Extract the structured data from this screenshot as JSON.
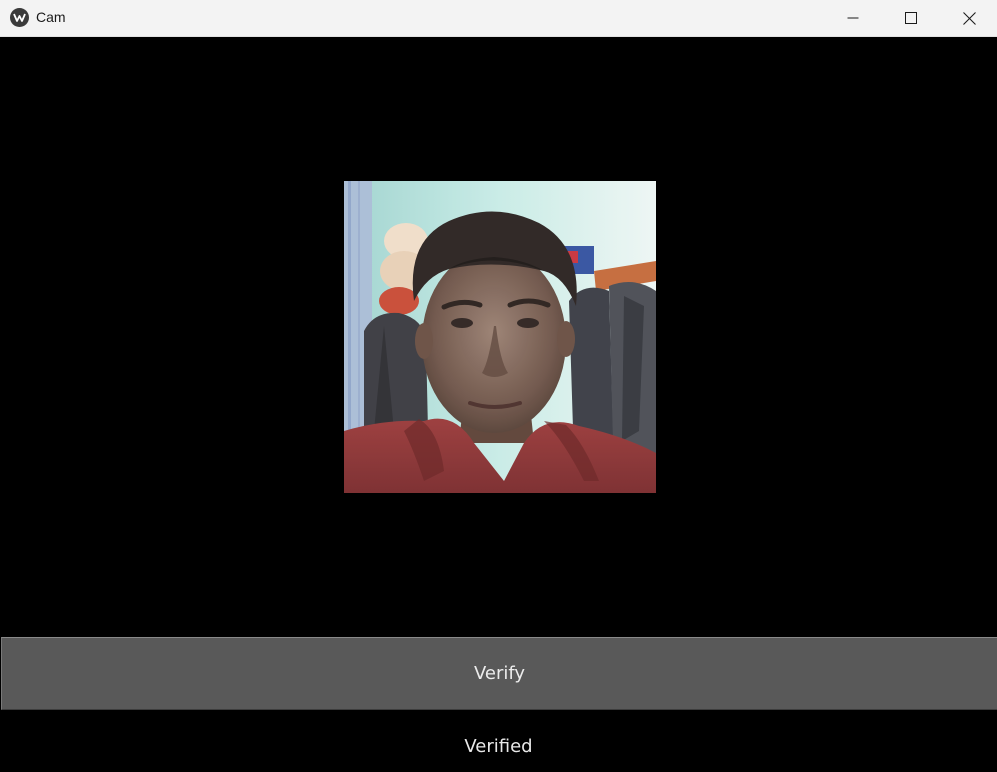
{
  "window": {
    "title": "Cam",
    "icon": "kivy-logo-icon"
  },
  "controls": {
    "minimize": "minimize-icon",
    "maximize": "maximize-icon",
    "close": "close-icon"
  },
  "camera": {
    "feed": "webcam-feed"
  },
  "actions": {
    "verify_label": "Verify"
  },
  "status": {
    "text": "Verified"
  },
  "colors": {
    "background": "#000000",
    "titlebar": "#f3f3f3",
    "button": "#595959",
    "text": "#ececec"
  }
}
